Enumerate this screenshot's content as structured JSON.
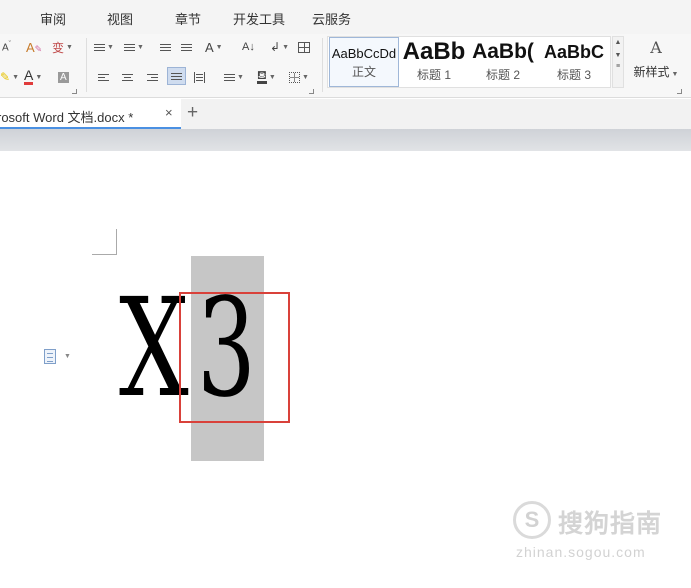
{
  "menu": {
    "items": [
      "审阅",
      "视图",
      "章节",
      "开发工具",
      "云服务"
    ]
  },
  "ribbon": {
    "font_color_glyph": "A",
    "shading_glyph": "A",
    "grow_font_glyph": "A",
    "phonetic_glyph": "变",
    "sort_glyph": "A↓",
    "style_gallery": [
      {
        "preview": "AaBbCcDd",
        "name": "正文"
      },
      {
        "preview": "AaBb",
        "name": "标题 1"
      },
      {
        "preview": "AaBb(",
        "name": "标题 2"
      },
      {
        "preview": "AaBbC",
        "name": "标题 3"
      }
    ],
    "new_style_glyph": "A",
    "new_style_label": "新样式"
  },
  "tabs": {
    "doc_title": "rosoft Word 文档.docx *",
    "close_glyph": "×",
    "new_tab_glyph": "+"
  },
  "document": {
    "char_x": "X",
    "char_3": "3"
  },
  "watermark": {
    "logo_glyph": "S",
    "text": "搜狗指南",
    "url": "zhinan.sogou.com"
  },
  "colors": {
    "accent": "#4a90e2",
    "selection": "#c6c6c6",
    "highlight_box": "#d9413a",
    "font_color_underline": "#e03b3b"
  }
}
